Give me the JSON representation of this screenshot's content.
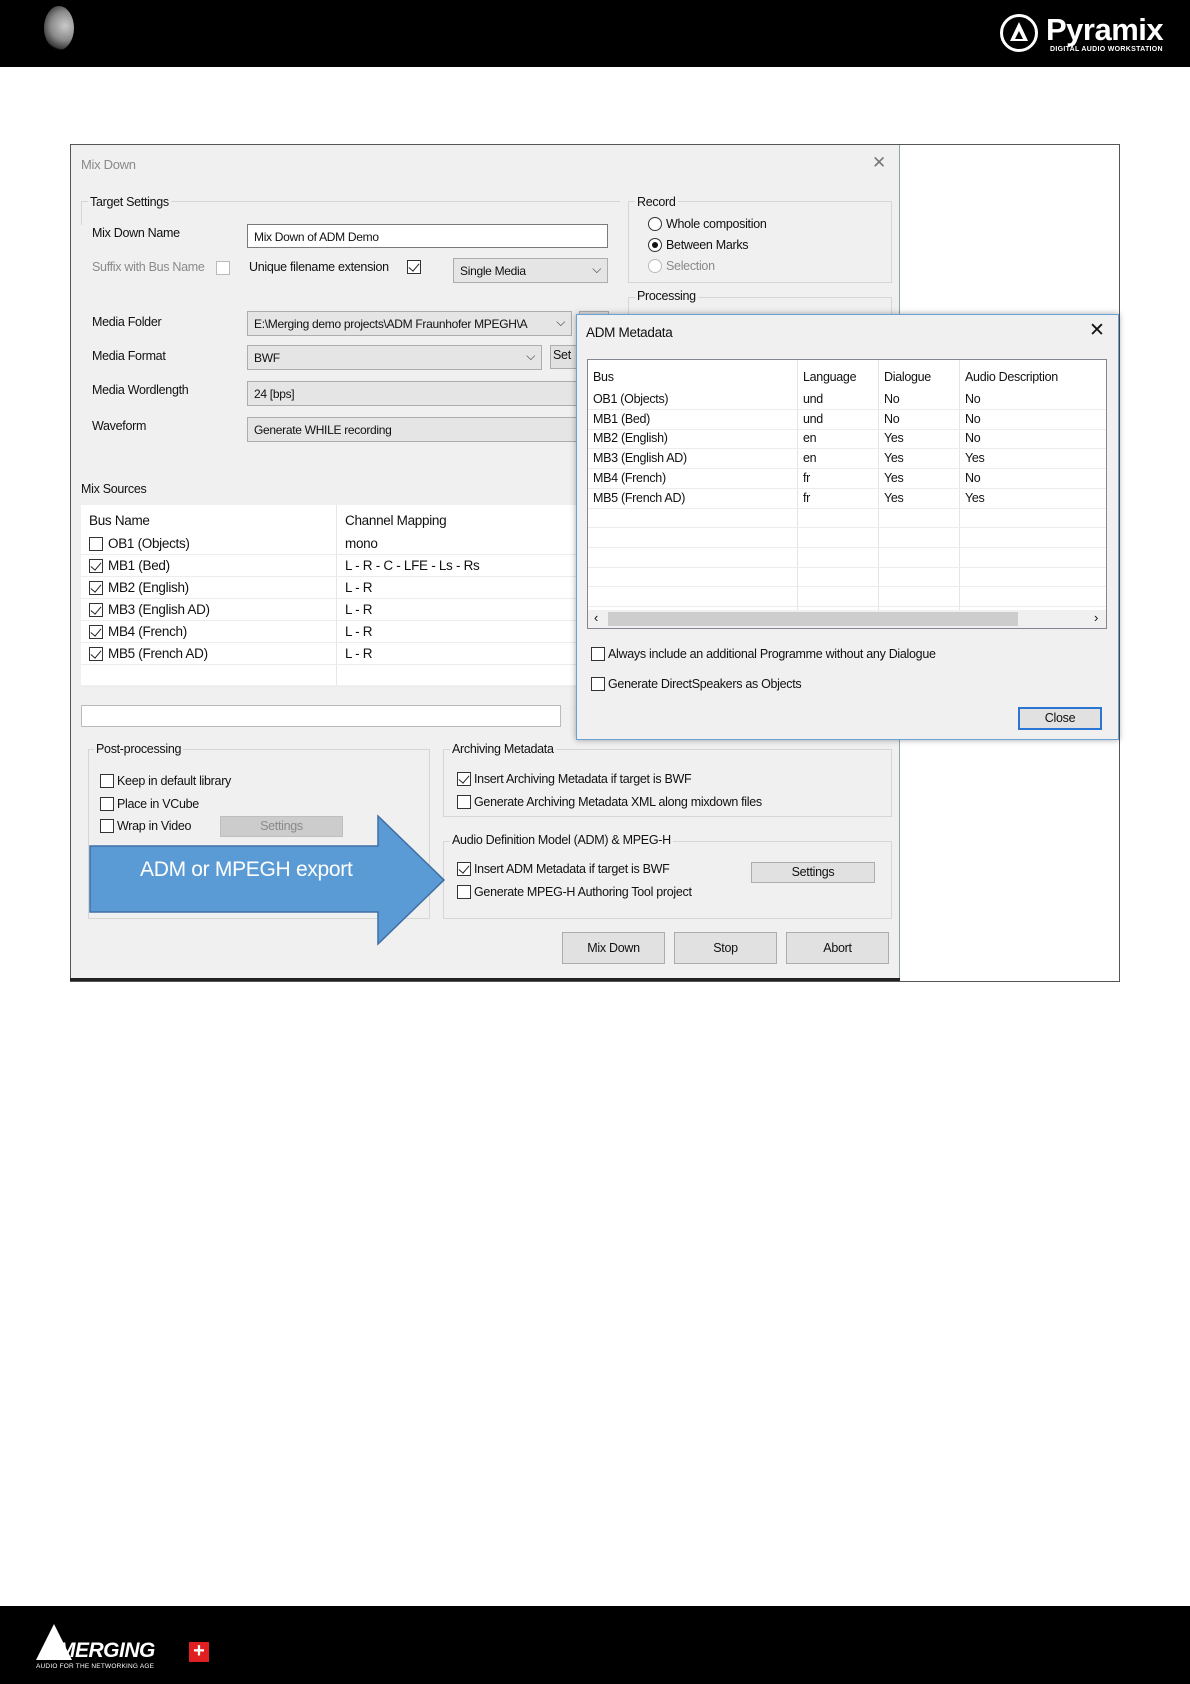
{
  "header": {
    "brand": "Pyramix",
    "brand_subtitle": "DIGITAL AUDIO WORKSTATION"
  },
  "footer": {
    "brand": "MERGING",
    "brand_subtitle": "AUDIO FOR THE NETWORKING AGE",
    "plus": "+"
  },
  "mixdown": {
    "title": "Mix Down",
    "close_glyph": "✕",
    "target_settings": {
      "group_label": "Target Settings",
      "name_label": "Mix Down Name",
      "name_value": "Mix Down of ADM Demo",
      "suffix_label": "Suffix with Bus Name",
      "unique_label": "Unique filename extension",
      "media_mode": "Single Media",
      "folder_label": "Media Folder",
      "folder_value": "E:\\Merging demo projects\\ADM Fraunhofer MPEGH\\A",
      "format_label": "Media Format",
      "format_value": "BWF",
      "format_settings_label": "Set",
      "wordlength_label": "Media Wordlength",
      "wordlength_value": "24 [bps]",
      "waveform_label": "Waveform",
      "waveform_value": "Generate WHILE recording"
    },
    "record": {
      "group_label": "Record",
      "options": [
        "Whole composition",
        "Between Marks",
        "Selection"
      ]
    },
    "processing_label": "Processing",
    "mix_sources": {
      "label": "Mix Sources",
      "columns": [
        "Bus Name",
        "Channel Mapping"
      ],
      "rows": [
        {
          "bus": "OB1 (Objects)",
          "mapping": "mono"
        },
        {
          "bus": "MB1 (Bed)",
          "mapping": "L - R - C - LFE - Ls - Rs"
        },
        {
          "bus": "MB2 (English)",
          "mapping": "L - R"
        },
        {
          "bus": "MB3 (English AD)",
          "mapping": "L - R"
        },
        {
          "bus": "MB4 (French)",
          "mapping": "L - R"
        },
        {
          "bus": "MB5 (French AD)",
          "mapping": "L - R"
        }
      ]
    },
    "post_processing": {
      "label": "Post-processing",
      "keep": "Keep in default library",
      "vcube": "Place in VCube",
      "wrap": "Wrap in Video",
      "settings": "Settings"
    },
    "archiving": {
      "label": "Archiving Metadata",
      "insert": "Insert Archiving Metadata if target is BWF",
      "generate": "Generate Archiving Metadata XML along mixdown files"
    },
    "adm": {
      "label": "Audio Definition Model (ADM) & MPEG-H",
      "insert": "Insert ADM Metadata if target is BWF",
      "generate": "Generate MPEG-H Authoring Tool project",
      "settings": "Settings"
    },
    "buttons": {
      "mixdown": "Mix Down",
      "stop": "Stop",
      "abort": "Abort"
    }
  },
  "callout": {
    "text": "ADM or MPEGH export",
    "color": "#5b9bd5"
  },
  "adm_metadata": {
    "title": "ADM Metadata",
    "close_glyph": "✕",
    "columns": [
      "Bus",
      "Language",
      "Dialogue",
      "Audio Description"
    ],
    "rows": [
      [
        "OB1 (Objects)",
        "und",
        "No",
        "No"
      ],
      [
        "MB1 (Bed)",
        "und",
        "No",
        "No"
      ],
      [
        "MB2 (English)",
        "en",
        "Yes",
        "No"
      ],
      [
        "MB3 (English AD)",
        "en",
        "Yes",
        "Yes"
      ],
      [
        "MB4 (French)",
        "fr",
        "Yes",
        "No"
      ],
      [
        "MB5 (French AD)",
        "fr",
        "Yes",
        "Yes"
      ]
    ],
    "always_include": "Always include an additional Programme without any Dialogue",
    "generate_ds": "Generate DirectSpeakers as Objects",
    "close_button": "Close"
  }
}
